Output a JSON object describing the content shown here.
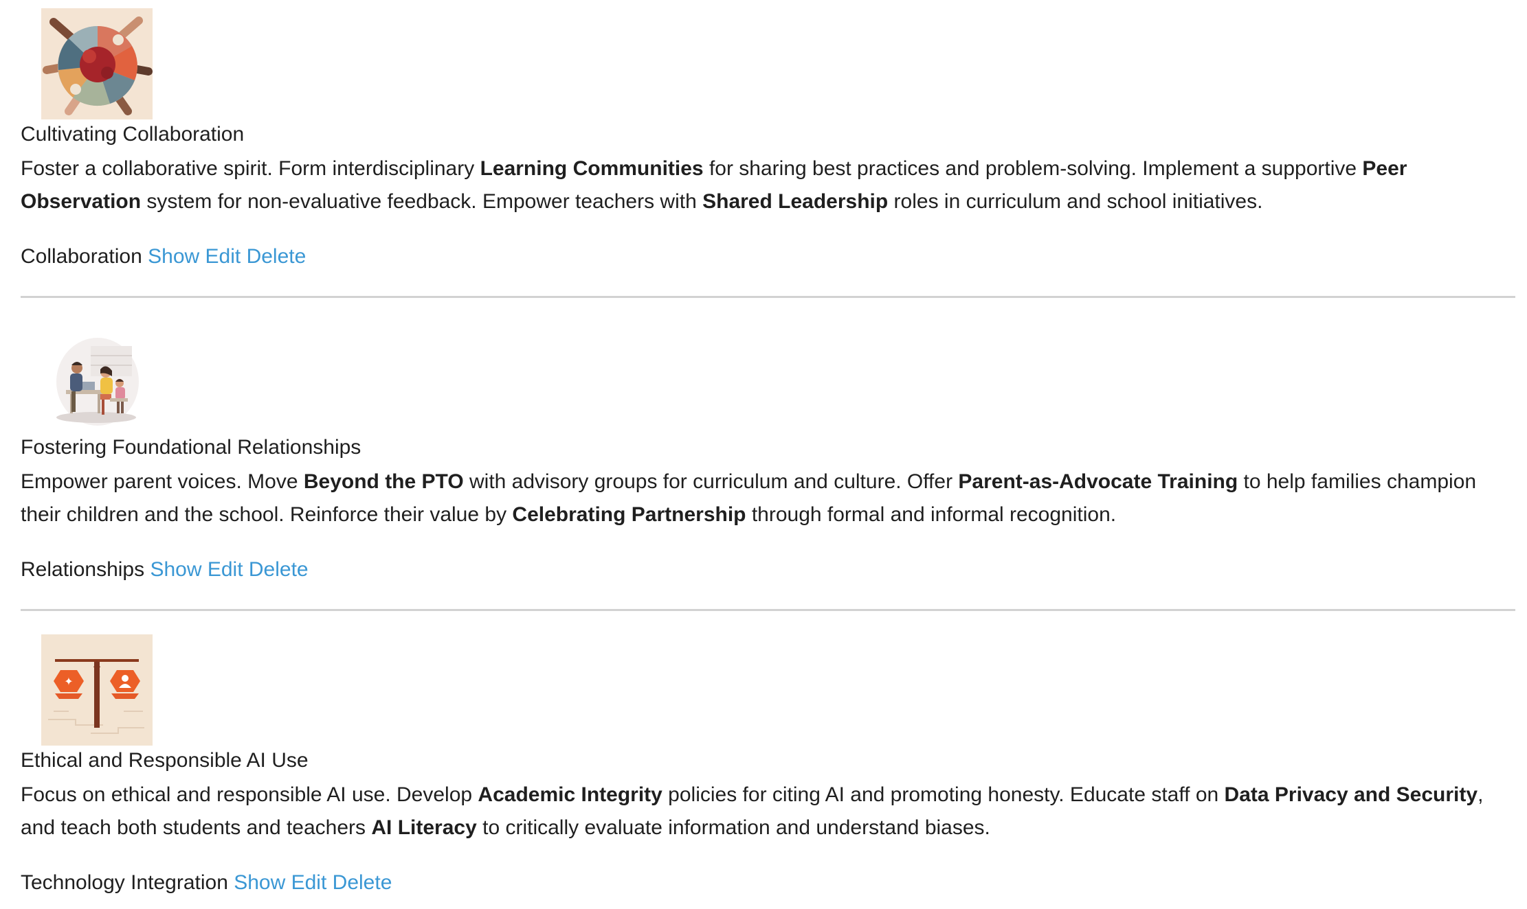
{
  "entries": [
    {
      "image": {
        "icon": "puzzle-hands-illustration",
        "bg": "#f4e4d3"
      },
      "title": "Cultivating Collaboration",
      "desc": [
        "Foster a collaborative spirit. Form interdisciplinary ",
        "Learning Communities",
        " for sharing best practices and problem-solving. Implement a supportive ",
        "Peer Observation",
        " system for non-evaluative feedback. Empower teachers with ",
        "Shared Leadership",
        " roles in curriculum and school initiatives."
      ],
      "category": "Collaboration",
      "actions": {
        "show": "Show",
        "edit": "Edit",
        "delete": "Delete"
      }
    },
    {
      "image": {
        "icon": "family-relationships-illustration",
        "bg": "#ffffff"
      },
      "title": "Fostering Foundational Relationships",
      "desc": [
        "Empower parent voices. Move ",
        "Beyond the PTO",
        " with advisory groups for curriculum and culture. Offer ",
        "Parent-as-Advocate Training",
        " to help families champion their children and the school. Reinforce their value by ",
        "Celebrating Partnership",
        " through formal and informal recognition."
      ],
      "category": "Relationships",
      "actions": {
        "show": "Show",
        "edit": "Edit",
        "delete": "Delete"
      }
    },
    {
      "image": {
        "icon": "balance-scale-ai-illustration",
        "bg": "#f3e4d2"
      },
      "title": "Ethical and Responsible AI Use",
      "desc": [
        "Focus on ethical and responsible AI use. Develop ",
        "Academic Integrity",
        " policies for citing AI and promoting honesty. Educate staff on ",
        "Data Privacy and Security",
        ", and teach both students and teachers ",
        "AI Literacy",
        " to critically evaluate information and understand biases."
      ],
      "category": "Technology Integration",
      "actions": {
        "show": "Show",
        "edit": "Edit",
        "delete": "Delete"
      }
    }
  ]
}
